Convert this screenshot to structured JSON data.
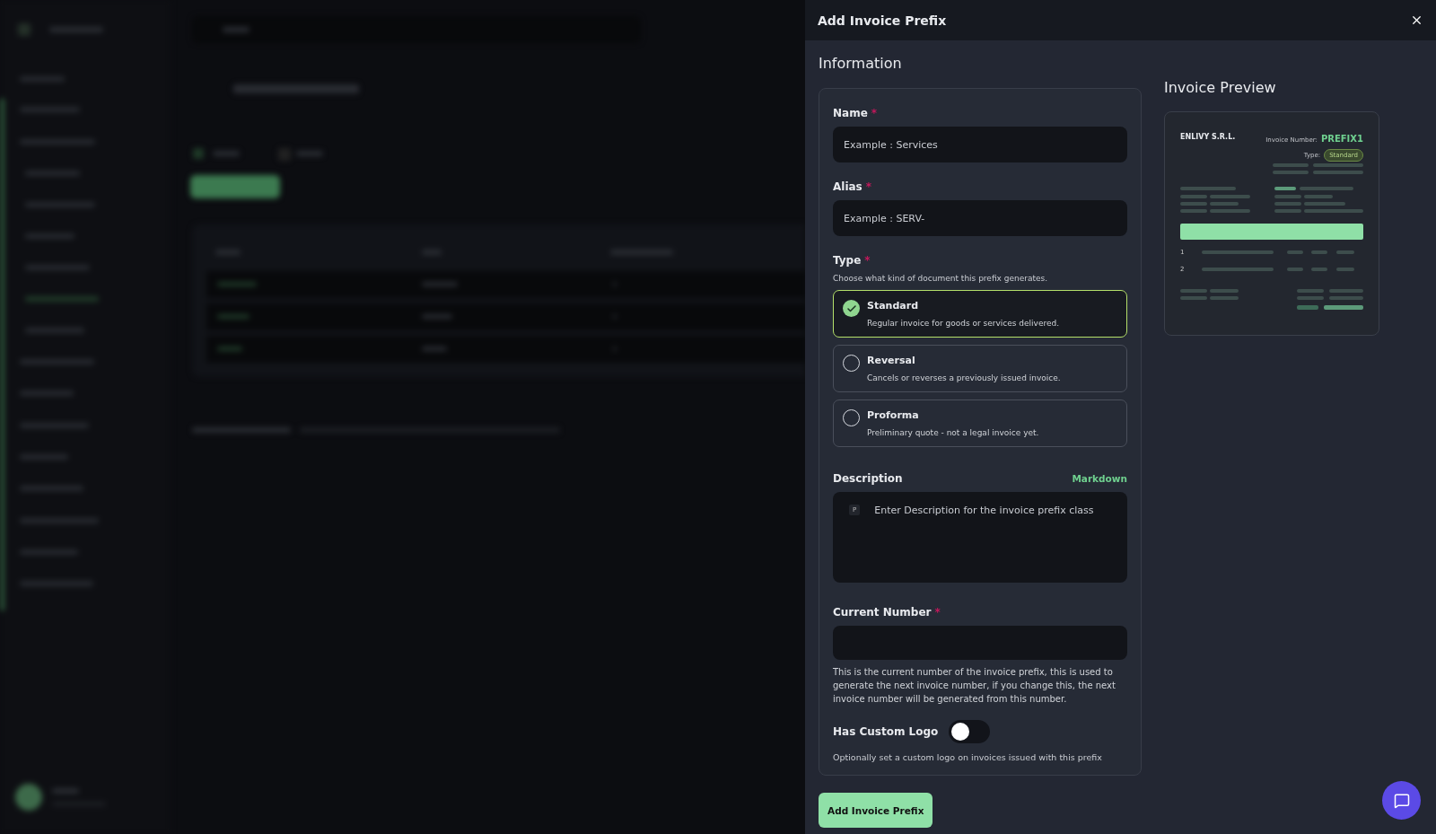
{
  "drawer": {
    "title": "Add Invoice Prefix",
    "section": "Information",
    "fields": [
      {
        "kind": "text",
        "label": "Name",
        "required_mark": "*",
        "placeholder": "Example : Services"
      },
      {
        "kind": "text",
        "label": "Alias",
        "required_mark": "*",
        "placeholder": "Example : SERV-"
      }
    ],
    "type": {
      "label": "Type",
      "required_mark": "*",
      "hint": "Choose what kind of document this prefix generates.",
      "options": [
        {
          "title": "Standard",
          "description": "Regular invoice for goods or services delivered.",
          "selected": true
        },
        {
          "title": "Reversal",
          "description": "Cancels or reverses a previously issued invoice.",
          "selected": false
        },
        {
          "title": "Proforma",
          "description": "Preliminary quote - not a legal invoice yet.",
          "selected": false
        }
      ]
    },
    "description": {
      "label": "Description",
      "link": "Markdown",
      "block_badge": "P",
      "placeholder": "Enter Description for the invoice prefix class"
    },
    "current_number": {
      "label": "Current Number",
      "required_mark": "*",
      "help": "This is the current number of the invoice prefix, this is used to generate the next invoice number, if you change this, the next invoice number will be generated from this number."
    },
    "custom_logo": {
      "label": "Has Custom Logo",
      "on": false,
      "hint": "Optionally set a custom logo on invoices issued with this prefix"
    },
    "submit": "Add Invoice Prefix",
    "preview": {
      "title": "Invoice Preview",
      "company": "ENLIVY S.R.L.",
      "number_label": "Invoice Number:",
      "number": "PREFIX1",
      "type_label": "Type:",
      "type": "Standard",
      "rows": [
        "1",
        "2"
      ]
    }
  }
}
